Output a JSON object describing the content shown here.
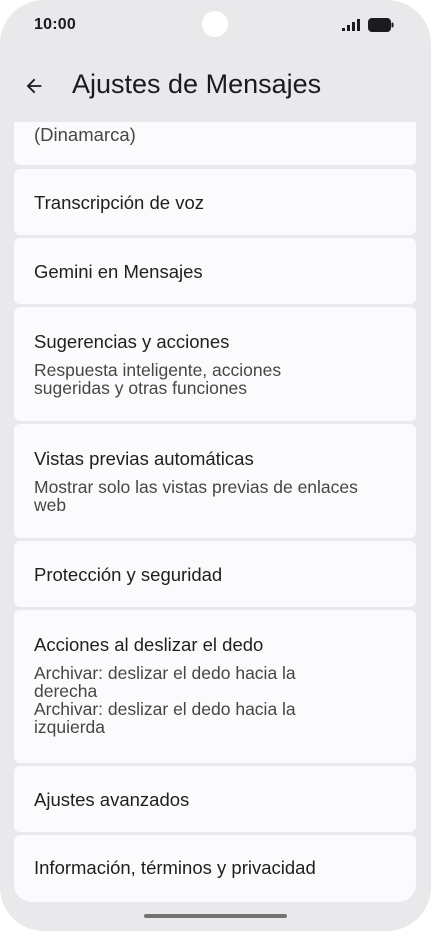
{
  "status_bar": {
    "time": "10:00"
  },
  "app_bar": {
    "title": "Ajustes de Mensajes",
    "back_icon": "arrow-back-icon"
  },
  "settings": {
    "partial_item": {
      "secondary": "(Dinamarca)"
    },
    "voice_transcription": {
      "title": "Transcripción de voz"
    },
    "gemini": {
      "title": "Gemini en Mensajes"
    },
    "suggestions": {
      "title": "Sugerencias y acciones",
      "subtitle_line1": "Respuesta inteligente, acciones",
      "subtitle_line2": "sugeridas y otras funciones"
    },
    "previews": {
      "title": "Vistas previas automáticas",
      "subtitle_line1": "Mostrar solo las vistas previas de enlaces",
      "subtitle_line2": "web"
    },
    "protection": {
      "title": "Protección y seguridad"
    },
    "swipe": {
      "title": "Acciones al deslizar el dedo",
      "subtitle_line1": "Archivar: deslizar el dedo hacia la",
      "subtitle_line2": "derecha",
      "subtitle_line3": "Archivar: deslizar el dedo hacia la",
      "subtitle_line4": "izquierda"
    },
    "advanced": {
      "title": "Ajustes avanzados"
    },
    "about": {
      "title": "Información, términos y privacidad"
    }
  },
  "colors": {
    "background": "#e9e9ec",
    "card": "#fbfbfd",
    "text_primary": "#1f1f1f",
    "text_secondary": "#444746"
  }
}
